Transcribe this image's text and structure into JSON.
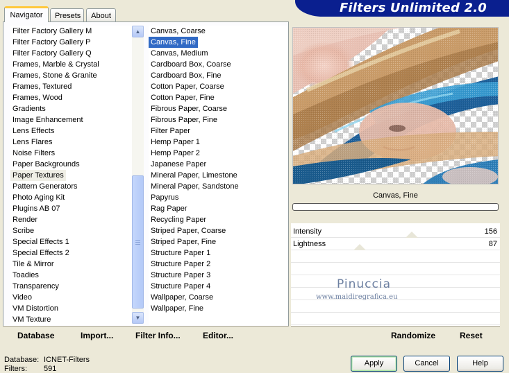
{
  "app": {
    "title": "Filters Unlimited 2.0"
  },
  "tabs": [
    {
      "label": "Navigator",
      "active": true
    },
    {
      "label": "Presets",
      "active": false
    },
    {
      "label": "About",
      "active": false
    }
  ],
  "categories": [
    "Filter Factory Gallery M",
    "Filter Factory Gallery P",
    "Filter Factory Gallery Q",
    "Frames, Marble & Crystal",
    "Frames, Stone & Granite",
    "Frames, Textured",
    "Frames, Wood",
    "Gradients",
    "Image Enhancement",
    "Lens Effects",
    "Lens Flares",
    "Noise Filters",
    "Paper Backgrounds",
    "Paper Textures",
    "Pattern Generators",
    "Photo Aging Kit",
    "Plugins AB 07",
    "Render",
    "Scribe",
    "Special Effects 1",
    "Special Effects 2",
    "Tile & Mirror",
    "Toadies",
    "Transparency",
    "Video",
    "VM Distortion",
    "VM Texture"
  ],
  "selected_category_index": 13,
  "filters": [
    "Canvas, Coarse",
    "Canvas, Fine",
    "Canvas, Medium",
    "Cardboard Box, Coarse",
    "Cardboard Box, Fine",
    "Cotton Paper, Coarse",
    "Cotton Paper, Fine",
    "Fibrous Paper, Coarse",
    "Fibrous Paper, Fine",
    "Filter Paper",
    "Hemp Paper 1",
    "Hemp Paper 2",
    "Japanese Paper",
    "Mineral Paper, Limestone",
    "Mineral Paper, Sandstone",
    "Papyrus",
    "Rag Paper",
    "Recycling Paper",
    "Striped Paper, Coarse",
    "Striped Paper, Fine",
    "Structure Paper 1",
    "Structure Paper 2",
    "Structure Paper 3",
    "Structure Paper 4",
    "Wallpaper, Coarse",
    "Wallpaper, Fine"
  ],
  "selected_filter_index": 1,
  "toolbar": {
    "database": "Database",
    "import": "Import...",
    "filter_info": "Filter Info...",
    "editor": "Editor...",
    "randomize": "Randomize",
    "reset": "Reset"
  },
  "preview": {
    "filter_name": "Canvas, Fine",
    "watermark_name": "Pinuccia",
    "watermark_url": "www.maidiregrafica.eu",
    "progress": 0
  },
  "sliders": [
    {
      "label": "Intensity",
      "value": "156",
      "max": 255
    },
    {
      "label": "Lightness",
      "value": "87",
      "max": 255
    }
  ],
  "status": {
    "database_label": "Database:",
    "database_value": "ICNET-Filters",
    "filters_label": "Filters:",
    "filters_value": "591"
  },
  "buttons": {
    "apply": "Apply",
    "cancel": "Cancel",
    "help": "Help"
  },
  "colors": {
    "banner": "#0a1f8f",
    "selection": "#316ac5",
    "tab_accent": "#ffc83c"
  }
}
